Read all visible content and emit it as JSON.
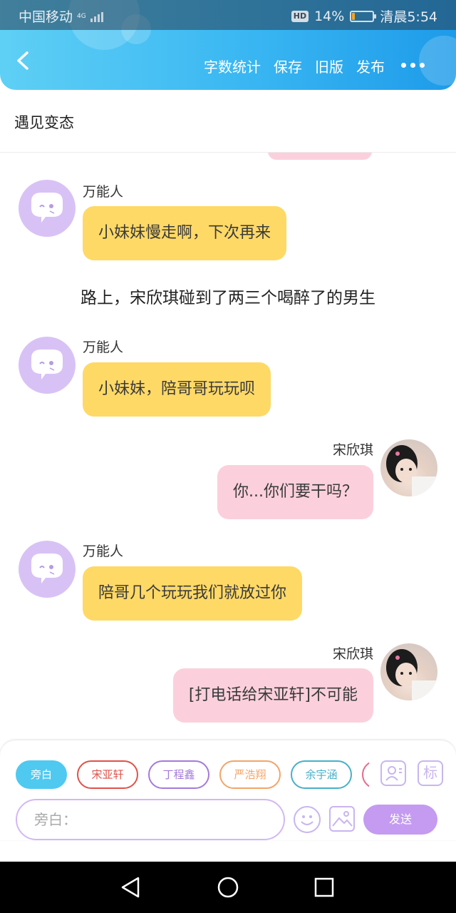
{
  "status_bar": {
    "carrier": "中国移动",
    "network": "4G",
    "hd": "HD",
    "battery": "14%",
    "battery_level": 0.14,
    "time": "清晨5:54"
  },
  "toolbar": {
    "word_count": "字数统计",
    "save": "保存",
    "old_version": "旧版",
    "publish": "发布"
  },
  "story_title": "遇见变态",
  "messages": [
    {
      "sender": "万能人",
      "text": "小妹妹慢走啊，下次再来"
    },
    {
      "narration": "路上，宋欣琪碰到了两三个喝醉了的男生"
    },
    {
      "sender": "万能人",
      "text": "小妹妹，陪哥哥玩玩呗"
    },
    {
      "sender": "宋欣琪",
      "text": "你...你们要干吗？"
    },
    {
      "sender": "万能人",
      "text": "陪哥几个玩玩我们就放过你"
    },
    {
      "sender": "宋欣琪",
      "text": "[打电话给宋亚轩]不可能"
    }
  ],
  "colors": {
    "header_blue": "#39b6f2",
    "bot_bubble": "#ffd966",
    "user_bubble": "#fbd0dc",
    "accent_purple": "#c49bf0"
  },
  "roles": [
    {
      "label": "旁白",
      "color": "#4fc9f0",
      "selected": true
    },
    {
      "label": "宋亚轩",
      "color": "#e0524a"
    },
    {
      "label": "丁程鑫",
      "color": "#a47adb"
    },
    {
      "label": "严浩翔",
      "color": "#f2a56a"
    },
    {
      "label": "余宇涵",
      "color": "#48b0c8"
    }
  ],
  "role_icon_label": "标",
  "input": {
    "placeholder": "旁白："
  },
  "send_label": "发送"
}
